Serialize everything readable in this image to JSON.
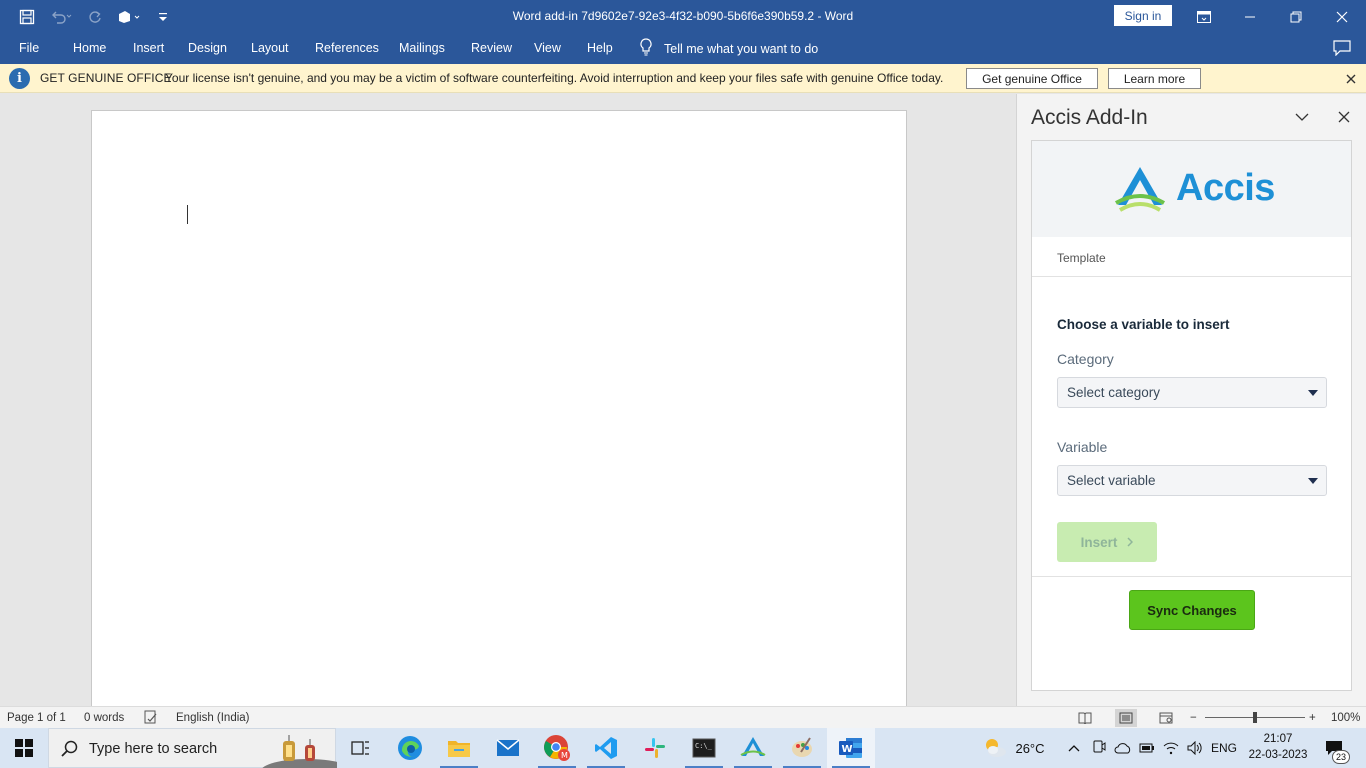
{
  "titlebar": {
    "document_title": "Word add-in 7d9602e7-92e3-4f32-b090-5b6f6e390b59.2  -  Word",
    "sign_in": "Sign in"
  },
  "ribbon": {
    "tabs": [
      "File",
      "Home",
      "Insert",
      "Design",
      "Layout",
      "References",
      "Mailings",
      "Review",
      "View",
      "Help"
    ],
    "tell_me": "Tell me what you want to do"
  },
  "genuine_bar": {
    "heading": "GET GENUINE OFFICE",
    "message": "Your license isn't genuine, and you may be a victim of software counterfeiting. Avoid interruption and keep your files safe with genuine Office today.",
    "get_button": "Get genuine Office",
    "learn_button": "Learn more"
  },
  "addin_pane": {
    "title": "Accis Add-In",
    "logo_text": "Accis",
    "nav_item": "Template",
    "heading": "Choose a variable to insert",
    "category_label": "Category",
    "category_placeholder": "Select category",
    "variable_label": "Variable",
    "variable_placeholder": "Select variable",
    "insert_button": "Insert",
    "sync_button": "Sync Changes",
    "brand_colors": {
      "blue": "#1e90d6",
      "green": "#5cc51d"
    }
  },
  "statusbar": {
    "page": "Page 1 of 1",
    "words": "0 words",
    "language": "English (India)",
    "zoom": "100%"
  },
  "taskbar": {
    "search_placeholder": "Type here to search",
    "weather": "26°C",
    "language": "ENG",
    "time": "21:07",
    "date": "22-03-2023",
    "notifications": "23"
  }
}
